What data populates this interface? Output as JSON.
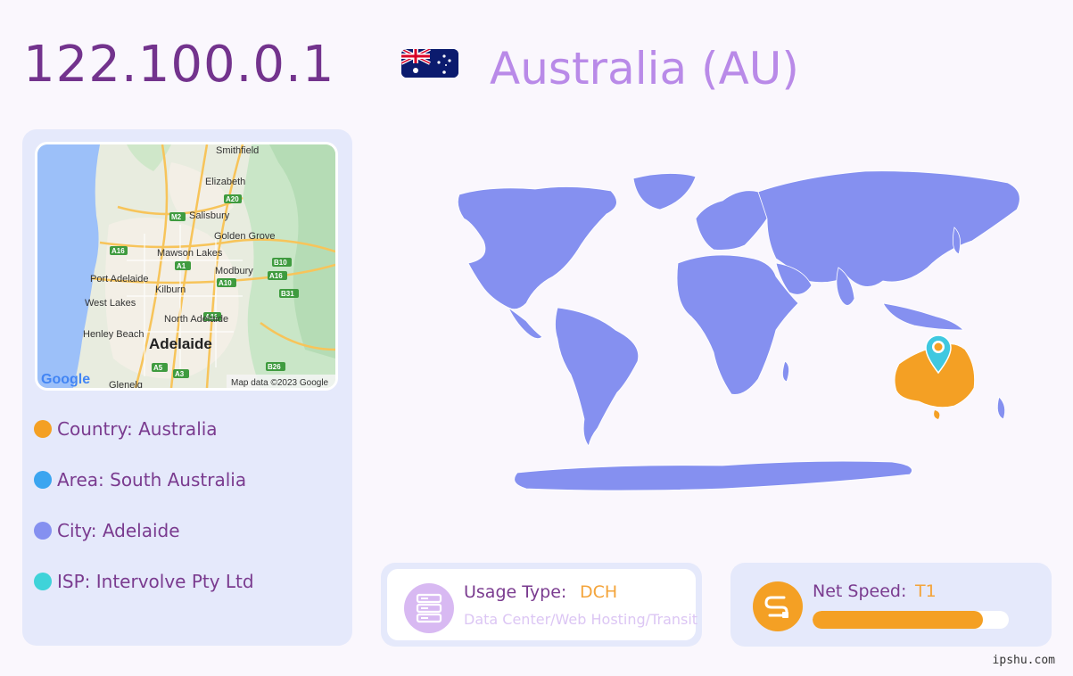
{
  "header": {
    "ip": "122.100.0.1",
    "country_title": "Australia (AU)",
    "flag_icon": "australia-flag-icon"
  },
  "minimap": {
    "places": [
      "Smithfield",
      "Elizabeth",
      "Salisbury",
      "Golden Grove",
      "Mawson Lakes",
      "Modbury",
      "Port Adelaide",
      "Kilburn",
      "West Lakes",
      "North Adelaide",
      "Henley Beach",
      "Adelaide",
      "Glenelg"
    ],
    "roads": [
      "A20",
      "M2",
      "A16",
      "A1",
      "B10",
      "A10",
      "A16",
      "B31",
      "A11",
      "A5",
      "A3",
      "B26"
    ],
    "google_logo": "Google",
    "attribution": "Map data ©2023 Google"
  },
  "info": {
    "country": {
      "text": "Country: Australia",
      "color": "#f4a024"
    },
    "area": {
      "text": "Area: South Australia",
      "color": "#3ba5f0"
    },
    "city": {
      "text": "City: Adelaide",
      "color": "#8590f0"
    },
    "isp": {
      "text": "ISP: Intervolve Pty Ltd",
      "color": "#3fd3d9"
    }
  },
  "world_map": {
    "land_color": "#8590f0",
    "highlight_color": "#f4a024",
    "marker_color": "#3fc8e0"
  },
  "usage": {
    "label": "Usage Type:",
    "value": "DCH",
    "description": "Data Center/Web Hosting/Transit",
    "icon": "server-icon"
  },
  "speed": {
    "label": "Net Speed:",
    "value": "T1",
    "level_percent": 87,
    "icon": "speed-icon"
  },
  "footer": {
    "watermark": "ipshu.com"
  }
}
